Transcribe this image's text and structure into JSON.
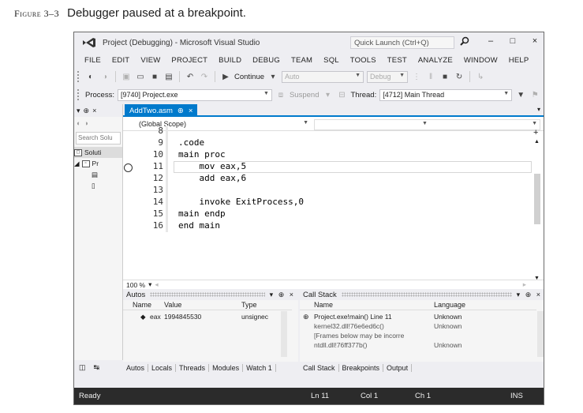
{
  "caption": {
    "figure_label": "Figure 3–3",
    "text": "Debugger paused at a breakpoint."
  },
  "window": {
    "title": "Project (Debugging) - Microsoft Visual Studio",
    "quick_launch_placeholder": "Quick Launch (Ctrl+Q)",
    "buttons": {
      "minimize": "–",
      "maximize": "□",
      "close": "×"
    }
  },
  "menu": [
    "FILE",
    "EDIT",
    "VIEW",
    "PROJECT",
    "BUILD",
    "DEBUG",
    "TEAM",
    "SQL",
    "TOOLS",
    "TEST",
    "ANALYZE",
    "WINDOW",
    "HELP"
  ],
  "toolbar1": {
    "continue_label": "Continue",
    "solution_platform": "Auto",
    "configuration": "Debug"
  },
  "toolbar2": {
    "process_label": "Process:",
    "process_value": "[9740] Project.exe",
    "suspend_label": "Suspend",
    "thread_label": "Thread:",
    "thread_value": "[4712] Main Thread"
  },
  "solution_explorer": {
    "search_placeholder": "Search Solu",
    "items": [
      "Soluti",
      "Pr"
    ]
  },
  "editor": {
    "tab_label": "AddTwo.asm",
    "tab_pin": "⊕",
    "tab_close": "×",
    "scope": "(Global Scope)",
    "zoom": "100 %",
    "lines": [
      {
        "num": "8",
        "code": ""
      },
      {
        "num": "9",
        "code": ".code"
      },
      {
        "num": "10",
        "code": "main proc"
      },
      {
        "num": "11",
        "code": "    mov eax,5"
      },
      {
        "num": "12",
        "code": "    add eax,6"
      },
      {
        "num": "13",
        "code": ""
      },
      {
        "num": "14",
        "code": "    invoke ExitProcess,0"
      },
      {
        "num": "15",
        "code": "main endp"
      },
      {
        "num": "16",
        "code": "end main"
      }
    ]
  },
  "autos": {
    "title": "Autos",
    "columns": [
      "Name",
      "Value",
      "Type"
    ],
    "rows": [
      {
        "name": "eax",
        "value": "1994845530",
        "type": "unsignec"
      }
    ],
    "tabs": [
      "Autos",
      "Locals",
      "Threads",
      "Modules",
      "Watch 1"
    ]
  },
  "callstack": {
    "title": "Call Stack",
    "columns": [
      "Name",
      "Language"
    ],
    "rows": [
      {
        "name": "Project.exe!main() Line 11",
        "lang": "Unknown"
      },
      {
        "name": "kernel32.dll!76e6ed6c()",
        "lang": "Unknown"
      },
      {
        "name": "[Frames below may be incorre",
        "lang": ""
      },
      {
        "name": "ntdll.dll!76ff377b()",
        "lang": "Unknown"
      }
    ],
    "tabs": [
      "Call Stack",
      "Breakpoints",
      "Output"
    ]
  },
  "statusbar": {
    "status": "Ready",
    "line": "Ln 11",
    "col": "Col 1",
    "ch": "Ch 1",
    "mode": "INS"
  }
}
